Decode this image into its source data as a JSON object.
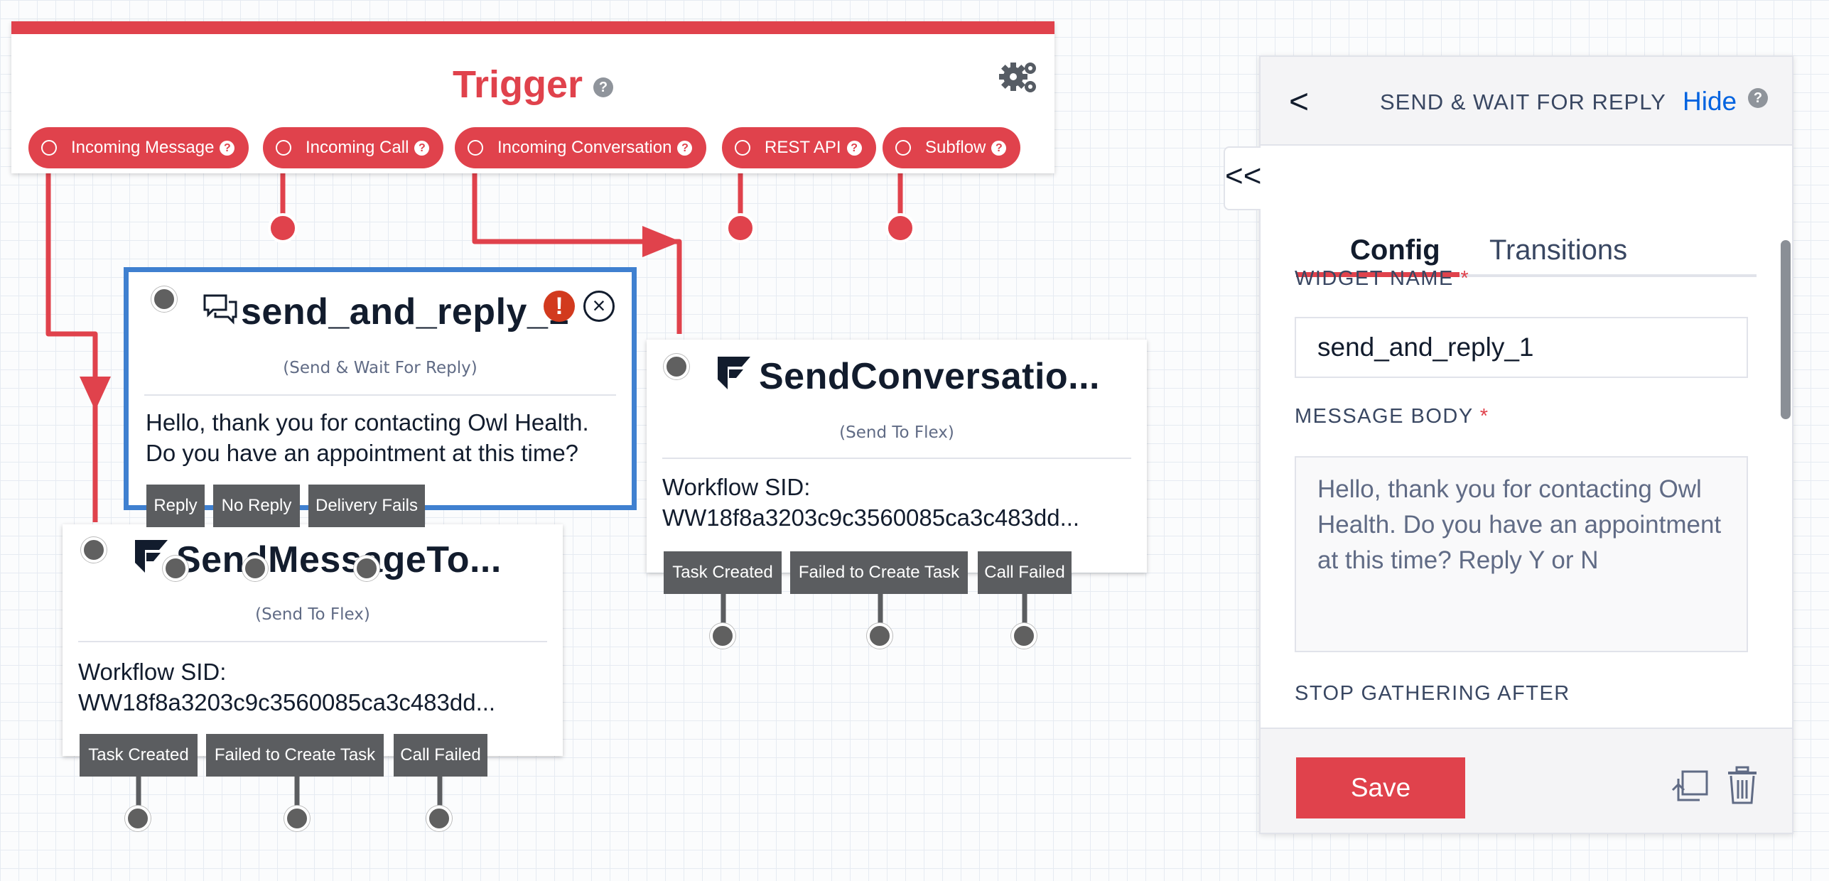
{
  "trigger": {
    "title": "Trigger",
    "help": "?",
    "pills": [
      "Incoming Message",
      "Incoming Call",
      "Incoming Conversation",
      "REST API",
      "Subflow"
    ]
  },
  "send_and_reply": {
    "title": "send_and_reply_1",
    "subtitle": "(Send & Wait For Reply)",
    "body_line1": "Hello, thank you for contacting Owl Health.",
    "body_line2": "Do you have an appointment at this time?",
    "transitions": [
      "Reply",
      "No Reply",
      "Delivery Fails"
    ]
  },
  "send_message_to_flex": {
    "title": "SendMessageTo...",
    "subtitle": "(Send To Flex)",
    "body_line1": "Workflow SID:",
    "body_line2": "WW18f8a3203c9c3560085ca3c483dd...",
    "transitions": [
      "Task Created",
      "Failed to Create Task",
      "Call Failed"
    ]
  },
  "send_conversation_to_flex": {
    "title": "SendConversatio...",
    "subtitle": "(Send To Flex)",
    "body_line1": "Workflow SID:",
    "body_line2": "WW18f8a3203c9c3560085ca3c483dd...",
    "transitions": [
      "Task Created",
      "Failed to Create Task",
      "Call Failed"
    ]
  },
  "panel": {
    "back": "<",
    "title": "SEND & WAIT FOR REPLY",
    "hide": "Hide",
    "help": "?",
    "collapse": "<<",
    "tabs": [
      "Config",
      "Transitions"
    ],
    "widget_name_label": "WIDGET NAME",
    "widget_name_value": "send_and_reply_1",
    "message_body_label": "MESSAGE BODY",
    "message_body_value": "Hello, thank you for contacting Owl Health. Do you have an appointment at this time? Reply Y or N",
    "stop_gathering_label": "STOP GATHERING AFTER",
    "required_marker": "*",
    "save": "Save"
  },
  "colors": {
    "accent_red": "#e0424c",
    "selected_blue": "#3f80d0",
    "link_blue": "#0263e0",
    "transition_gray": "#5b5d60",
    "error_red": "#d23a1e"
  },
  "icons": [
    "gear-icon",
    "help-icon",
    "chat-bubble-icon",
    "error-icon",
    "close-icon",
    "flex-logo-icon",
    "chevron-left-icon",
    "double-chevron-left-icon",
    "duplicate-icon",
    "trash-icon"
  ]
}
